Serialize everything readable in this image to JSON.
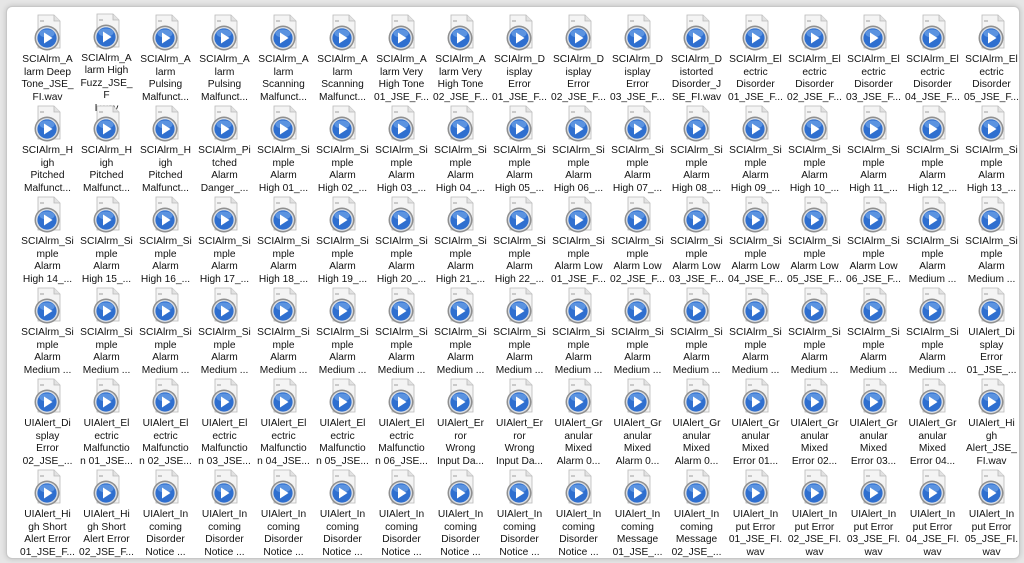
{
  "window": {
    "title": ""
  },
  "colors": {
    "icon_blue": "#2f6fcf",
    "icon_page": "#f4f4f4",
    "icon_ring": "#8f8f8f"
  },
  "icon": "wav-media-file-icon",
  "files": [
    {
      "label": "SCIAlrm_A\nlarm Deep\nTone_JSE_\nFI.wav"
    },
    {
      "label": "SCIAlrm_A\nlarm High\nFuzz_JSE_F\nI.wav"
    },
    {
      "label": "SCIAlrm_A\nlarm\nPulsing\nMalfunct..."
    },
    {
      "label": "SCIAlrm_A\nlarm\nPulsing\nMalfunct..."
    },
    {
      "label": "SCIAlrm_A\nlarm\nScanning\nMalfunct..."
    },
    {
      "label": "SCIAlrm_A\nlarm\nScanning\nMalfunct..."
    },
    {
      "label": "SCIAlrm_A\nlarm Very\nHigh Tone\n01_JSE_F..."
    },
    {
      "label": "SCIAlrm_A\nlarm Very\nHigh Tone\n02_JSE_F..."
    },
    {
      "label": "SCIAlrm_D\nisplay\nError\n01_JSE_F..."
    },
    {
      "label": "SCIAlrm_D\nisplay\nError\n02_JSE_F..."
    },
    {
      "label": "SCIAlrm_D\nisplay\nError\n03_JSE_F..."
    },
    {
      "label": "SCIAlrm_D\nistorted\nDisorder_J\nSE_FI.wav"
    },
    {
      "label": "SCIAlrm_El\nectric\nDisorder\n01_JSE_F..."
    },
    {
      "label": "SCIAlrm_El\nectric\nDisorder\n02_JSE_F..."
    },
    {
      "label": "SCIAlrm_El\nectric\nDisorder\n03_JSE_F..."
    },
    {
      "label": "SCIAlrm_El\nectric\nDisorder\n04_JSE_F..."
    },
    {
      "label": "SCIAlrm_El\nectric\nDisorder\n05_JSE_F..."
    },
    {
      "label": "SCIAlrm_H\nigh\nPitched\nMalfunct..."
    },
    {
      "label": "SCIAlrm_H\nigh\nPitched\nMalfunct..."
    },
    {
      "label": "SCIAlrm_H\nigh\nPitched\nMalfunct..."
    },
    {
      "label": "SCIAlrm_Pi\ntched\nAlarm\nDanger_..."
    },
    {
      "label": "SCIAlrm_Si\nmple\nAlarm\nHigh 01_..."
    },
    {
      "label": "SCIAlrm_Si\nmple\nAlarm\nHigh 02_..."
    },
    {
      "label": "SCIAlrm_Si\nmple\nAlarm\nHigh 03_..."
    },
    {
      "label": "SCIAlrm_Si\nmple\nAlarm\nHigh 04_..."
    },
    {
      "label": "SCIAlrm_Si\nmple\nAlarm\nHigh 05_..."
    },
    {
      "label": "SCIAlrm_Si\nmple\nAlarm\nHigh 06_..."
    },
    {
      "label": "SCIAlrm_Si\nmple\nAlarm\nHigh 07_..."
    },
    {
      "label": "SCIAlrm_Si\nmple\nAlarm\nHigh 08_..."
    },
    {
      "label": "SCIAlrm_Si\nmple\nAlarm\nHigh 09_..."
    },
    {
      "label": "SCIAlrm_Si\nmple\nAlarm\nHigh 10_..."
    },
    {
      "label": "SCIAlrm_Si\nmple\nAlarm\nHigh 11_..."
    },
    {
      "label": "SCIAlrm_Si\nmple\nAlarm\nHigh 12_..."
    },
    {
      "label": "SCIAlrm_Si\nmple\nAlarm\nHigh 13_..."
    },
    {
      "label": "SCIAlrm_Si\nmple\nAlarm\nHigh 14_..."
    },
    {
      "label": "SCIAlrm_Si\nmple\nAlarm\nHigh 15_..."
    },
    {
      "label": "SCIAlrm_Si\nmple\nAlarm\nHigh 16_..."
    },
    {
      "label": "SCIAlrm_Si\nmple\nAlarm\nHigh 17_..."
    },
    {
      "label": "SCIAlrm_Si\nmple\nAlarm\nHigh 18_..."
    },
    {
      "label": "SCIAlrm_Si\nmple\nAlarm\nHigh 19_..."
    },
    {
      "label": "SCIAlrm_Si\nmple\nAlarm\nHigh 20_..."
    },
    {
      "label": "SCIAlrm_Si\nmple\nAlarm\nHigh 21_..."
    },
    {
      "label": "SCIAlrm_Si\nmple\nAlarm\nHigh 22_..."
    },
    {
      "label": "SCIAlrm_Si\nmple\nAlarm Low\n01_JSE_F..."
    },
    {
      "label": "SCIAlrm_Si\nmple\nAlarm Low\n02_JSE_F..."
    },
    {
      "label": "SCIAlrm_Si\nmple\nAlarm Low\n03_JSE_F..."
    },
    {
      "label": "SCIAlrm_Si\nmple\nAlarm Low\n04_JSE_F..."
    },
    {
      "label": "SCIAlrm_Si\nmple\nAlarm Low\n05_JSE_F..."
    },
    {
      "label": "SCIAlrm_Si\nmple\nAlarm Low\n06_JSE_F..."
    },
    {
      "label": "SCIAlrm_Si\nmple\nAlarm\nMedium ..."
    },
    {
      "label": "SCIAlrm_Si\nmple\nAlarm\nMedium ..."
    },
    {
      "label": "SCIAlrm_Si\nmple\nAlarm\nMedium ..."
    },
    {
      "label": "SCIAlrm_Si\nmple\nAlarm\nMedium ..."
    },
    {
      "label": "SCIAlrm_Si\nmple\nAlarm\nMedium ..."
    },
    {
      "label": "SCIAlrm_Si\nmple\nAlarm\nMedium ..."
    },
    {
      "label": "SCIAlrm_Si\nmple\nAlarm\nMedium ..."
    },
    {
      "label": "SCIAlrm_Si\nmple\nAlarm\nMedium ..."
    },
    {
      "label": "SCIAlrm_Si\nmple\nAlarm\nMedium ..."
    },
    {
      "label": "SCIAlrm_Si\nmple\nAlarm\nMedium ..."
    },
    {
      "label": "SCIAlrm_Si\nmple\nAlarm\nMedium ..."
    },
    {
      "label": "SCIAlrm_Si\nmple\nAlarm\nMedium ..."
    },
    {
      "label": "SCIAlrm_Si\nmple\nAlarm\nMedium ..."
    },
    {
      "label": "SCIAlrm_Si\nmple\nAlarm\nMedium ..."
    },
    {
      "label": "SCIAlrm_Si\nmple\nAlarm\nMedium ..."
    },
    {
      "label": "SCIAlrm_Si\nmple\nAlarm\nMedium ..."
    },
    {
      "label": "SCIAlrm_Si\nmple\nAlarm\nMedium ..."
    },
    {
      "label": "SCIAlrm_Si\nmple\nAlarm\nMedium ..."
    },
    {
      "label": "UIAlert_Di\nsplay\nError\n01_JSE_..."
    },
    {
      "label": "UIAlert_Di\nsplay\nError\n02_JSE_..."
    },
    {
      "label": "UIAlert_El\nectric\nMalfunctio\nn 01_JSE..."
    },
    {
      "label": "UIAlert_El\nectric\nMalfunctio\nn 02_JSE..."
    },
    {
      "label": "UIAlert_El\nectric\nMalfunctio\nn 03_JSE..."
    },
    {
      "label": "UIAlert_El\nectric\nMalfunctio\nn 04_JSE..."
    },
    {
      "label": "UIAlert_El\nectric\nMalfunctio\nn 05_JSE..."
    },
    {
      "label": "UIAlert_El\nectric\nMalfunctio\nn 06_JSE..."
    },
    {
      "label": "UIAlert_Er\nror\nWrong\nInput Da..."
    },
    {
      "label": "UIAlert_Er\nror\nWrong\nInput Da..."
    },
    {
      "label": "UIAlert_Gr\nanular\nMixed\nAlarm 0..."
    },
    {
      "label": "UIAlert_Gr\nanular\nMixed\nAlarm 0..."
    },
    {
      "label": "UIAlert_Gr\nanular\nMixed\nAlarm 0..."
    },
    {
      "label": "UIAlert_Gr\nanular\nMixed\nError 01..."
    },
    {
      "label": "UIAlert_Gr\nanular\nMixed\nError 02..."
    },
    {
      "label": "UIAlert_Gr\nanular\nMixed\nError 03..."
    },
    {
      "label": "UIAlert_Gr\nanular\nMixed\nError 04..."
    },
    {
      "label": "UIAlert_Hi\ngh\nAlert_JSE_\nFI.wav"
    },
    {
      "label": "UIAlert_Hi\ngh Short\nAlert Error\n01_JSE_F..."
    },
    {
      "label": "UIAlert_Hi\ngh Short\nAlert Error\n02_JSE_F..."
    },
    {
      "label": "UIAlert_In\ncoming\nDisorder\nNotice ..."
    },
    {
      "label": "UIAlert_In\ncoming\nDisorder\nNotice ..."
    },
    {
      "label": "UIAlert_In\ncoming\nDisorder\nNotice ..."
    },
    {
      "label": "UIAlert_In\ncoming\nDisorder\nNotice ..."
    },
    {
      "label": "UIAlert_In\ncoming\nDisorder\nNotice ..."
    },
    {
      "label": "UIAlert_In\ncoming\nDisorder\nNotice ..."
    },
    {
      "label": "UIAlert_In\ncoming\nDisorder\nNotice ..."
    },
    {
      "label": "UIAlert_In\ncoming\nDisorder\nNotice ..."
    },
    {
      "label": "UIAlert_In\ncoming\nMessage\n01_JSE_..."
    },
    {
      "label": "UIAlert_In\ncoming\nMessage\n02_JSE_..."
    },
    {
      "label": "UIAlert_In\nput Error\n01_JSE_FI.\nwav"
    },
    {
      "label": "UIAlert_In\nput Error\n02_JSE_FI.\nwav"
    },
    {
      "label": "UIAlert_In\nput Error\n03_JSE_FI.\nwav"
    },
    {
      "label": "UIAlert_In\nput Error\n04_JSE_FI.\nwav"
    },
    {
      "label": "UIAlert_In\nput Error\n05_JSE_FI.\nwav"
    }
  ]
}
